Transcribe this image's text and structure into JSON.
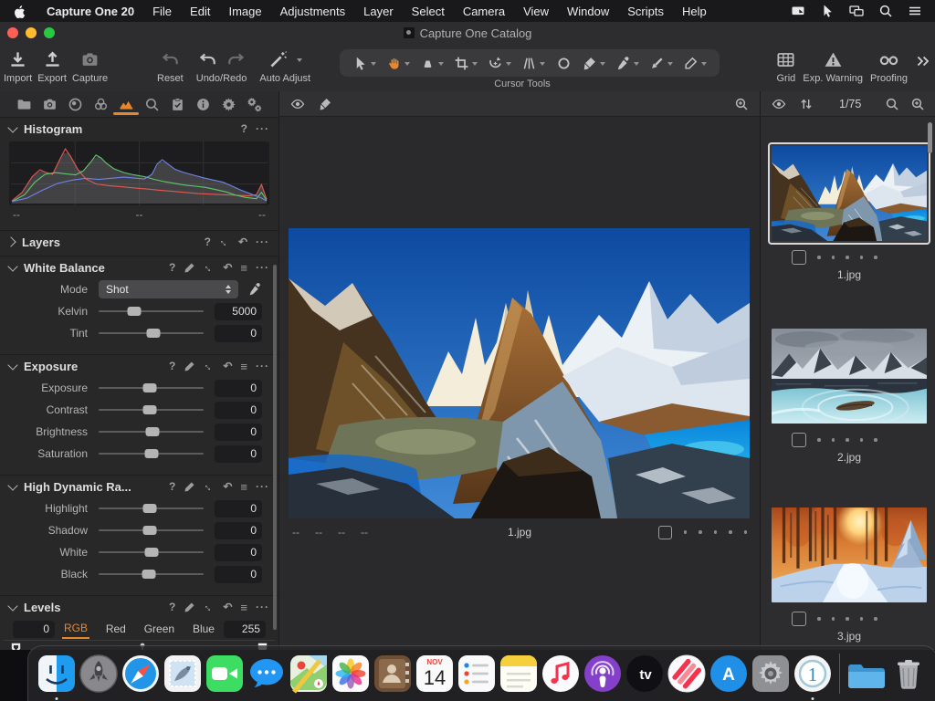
{
  "menu_bar": {
    "app_name": "Capture One 20",
    "items": [
      "File",
      "Edit",
      "Image",
      "Adjustments",
      "Layer",
      "Select",
      "Camera",
      "View",
      "Window",
      "Scripts",
      "Help"
    ],
    "status_icons": [
      "screen-mirroring",
      "pointer",
      "displays",
      "spotlight",
      "menu-list"
    ]
  },
  "title_bar": {
    "title": "Capture One Catalog"
  },
  "toolbar": {
    "import": "Import",
    "export": "Export",
    "capture": "Capture",
    "reset": "Reset",
    "undo_redo": "Undo/Redo",
    "auto_adjust": "Auto Adjust",
    "cursor_tools_label": "Cursor Tools",
    "grid": "Grid",
    "exp_warning": "Exp. Warning",
    "proofing": "Proofing"
  },
  "cursor_tools": {
    "active": "pan",
    "tools": [
      "select",
      "pan",
      "loupe",
      "crop",
      "rotate",
      "keystone",
      "spot",
      "draw-mask",
      "pick-color",
      "gradient-mask",
      "erase-mask"
    ]
  },
  "tool_tabs": {
    "active": "exposure",
    "tabs": [
      "library",
      "capture",
      "lens",
      "color",
      "exposure",
      "details",
      "adjustments",
      "metadata",
      "output",
      "batch"
    ]
  },
  "ui": {
    "help_glyph": "?",
    "dots_glyph": "···",
    "menu_glyph": "≡",
    "expand_glyph": "↔",
    "undo_glyph": "↶"
  },
  "panels": {
    "histogram": {
      "title": "Histogram",
      "ticks": [
        "--",
        "--",
        "--"
      ],
      "curves": {
        "red": [
          [
            0,
            3
          ],
          [
            4,
            18
          ],
          [
            8,
            46
          ],
          [
            11,
            58
          ],
          [
            13,
            54
          ],
          [
            16,
            50
          ],
          [
            19,
            78
          ],
          [
            21,
            95
          ],
          [
            23,
            82
          ],
          [
            26,
            58
          ],
          [
            29,
            42
          ],
          [
            33,
            33
          ],
          [
            38,
            30
          ],
          [
            43,
            28
          ],
          [
            48,
            26
          ],
          [
            53,
            24
          ],
          [
            58,
            22
          ],
          [
            63,
            20
          ],
          [
            68,
            18
          ],
          [
            73,
            16
          ],
          [
            78,
            15
          ],
          [
            83,
            14
          ],
          [
            88,
            13
          ],
          [
            93,
            12
          ],
          [
            96,
            14
          ],
          [
            98,
            32
          ],
          [
            100,
            6
          ]
        ],
        "green": [
          [
            0,
            2
          ],
          [
            5,
            14
          ],
          [
            9,
            36
          ],
          [
            13,
            50
          ],
          [
            17,
            53
          ],
          [
            21,
            51
          ],
          [
            25,
            49
          ],
          [
            28,
            56
          ],
          [
            31,
            72
          ],
          [
            33,
            84
          ],
          [
            35,
            79
          ],
          [
            37,
            70
          ],
          [
            40,
            60
          ],
          [
            44,
            53
          ],
          [
            48,
            49
          ],
          [
            52,
            46
          ],
          [
            56,
            41
          ],
          [
            60,
            37
          ],
          [
            64,
            34
          ],
          [
            68,
            31
          ],
          [
            72,
            29
          ],
          [
            76,
            27
          ],
          [
            80,
            23
          ],
          [
            84,
            19
          ],
          [
            88,
            13
          ],
          [
            92,
            9
          ],
          [
            96,
            7
          ],
          [
            98,
            18
          ],
          [
            100,
            4
          ]
        ],
        "blue": [
          [
            0,
            2
          ],
          [
            6,
            8
          ],
          [
            12,
            22
          ],
          [
            18,
            34
          ],
          [
            24,
            40
          ],
          [
            29,
            43
          ],
          [
            34,
            41
          ],
          [
            39,
            43
          ],
          [
            44,
            45
          ],
          [
            49,
            43
          ],
          [
            52,
            42
          ],
          [
            55,
            50
          ],
          [
            57,
            68
          ],
          [
            59,
            76
          ],
          [
            61,
            69
          ],
          [
            64,
            59
          ],
          [
            67,
            54
          ],
          [
            71,
            49
          ],
          [
            75,
            44
          ],
          [
            79,
            40
          ],
          [
            83,
            36
          ],
          [
            86,
            30
          ],
          [
            90,
            22
          ],
          [
            94,
            15
          ],
          [
            98,
            8
          ],
          [
            100,
            3
          ]
        ]
      }
    },
    "layers": {
      "title": "Layers"
    },
    "white_balance": {
      "title": "White Balance",
      "mode_label": "Mode",
      "mode_value": "Shot",
      "kelvin": {
        "label": "Kelvin",
        "value": "5000",
        "pos": 34
      },
      "tint": {
        "label": "Tint",
        "value": "0",
        "pos": 52
      }
    },
    "exposure": {
      "title": "Exposure",
      "rows": [
        {
          "label": "Exposure",
          "value": "0",
          "pos": 49
        },
        {
          "label": "Contrast",
          "value": "0",
          "pos": 49
        },
        {
          "label": "Brightness",
          "value": "0",
          "pos": 51
        },
        {
          "label": "Saturation",
          "value": "0",
          "pos": 50
        }
      ]
    },
    "hdr": {
      "title": "High Dynamic Ra...",
      "rows": [
        {
          "label": "Highlight",
          "value": "0",
          "pos": 49
        },
        {
          "label": "Shadow",
          "value": "0",
          "pos": 49
        },
        {
          "label": "White",
          "value": "0",
          "pos": 50
        },
        {
          "label": "Black",
          "value": "0",
          "pos": 48
        }
      ]
    },
    "levels": {
      "title": "Levels",
      "min": "0",
      "max": "255",
      "channels": [
        "RGB",
        "Red",
        "Green",
        "Blue"
      ],
      "active_channel": "RGB"
    }
  },
  "viewer": {
    "filename": "1.jpg",
    "exif_placeholders": [
      "--",
      "--",
      "--",
      "--"
    ],
    "rating_dots": 5
  },
  "browser": {
    "counter": "1/75",
    "thumbs": [
      {
        "name": "1.jpg",
        "selected": true,
        "art": "mountain"
      },
      {
        "name": "2.jpg",
        "selected": false,
        "art": "icelake"
      },
      {
        "name": "3.jpg",
        "selected": false,
        "art": "forest"
      }
    ]
  },
  "dock": {
    "apps": [
      "finder",
      "launchpad",
      "safari",
      "mail",
      "facetime",
      "messages",
      "maps",
      "photos",
      "contacts",
      "calendar",
      "reminders",
      "notes",
      "music",
      "podcasts",
      "tv",
      "news",
      "app-store",
      "system-preferences",
      "capture-one",
      "separator",
      "downloads-folder",
      "trash"
    ],
    "running": [
      "finder",
      "capture-one"
    ],
    "calendar": {
      "month": "NOV",
      "day": "14"
    },
    "tv_label": "tv",
    "app_store_label": "A",
    "capture_one_label": "1"
  },
  "colors": {
    "accent": "#e8862c"
  }
}
